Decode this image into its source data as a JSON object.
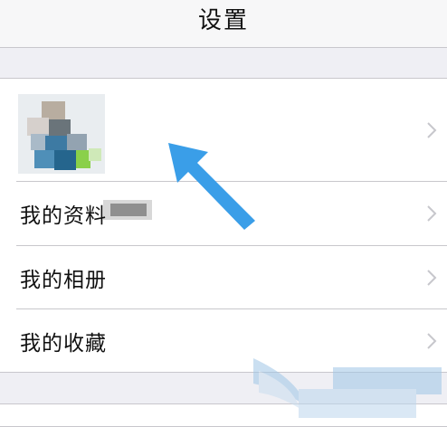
{
  "nav": {
    "title": "设置"
  },
  "profile": {
    "avatar_description": "blurred avatar",
    "nickname": "blurred"
  },
  "menu": {
    "items": [
      {
        "label": "我的资料"
      },
      {
        "label": "我的相册"
      },
      {
        "label": "我的收藏"
      }
    ]
  },
  "icons": {
    "chevron": "chevron-right-icon",
    "arrow": "arrow-annotation-icon"
  },
  "colors": {
    "background": "#efeff4",
    "separator": "#c8c7cc",
    "chevron": "#c7c7cc",
    "arrow": "#3a9ee8"
  }
}
